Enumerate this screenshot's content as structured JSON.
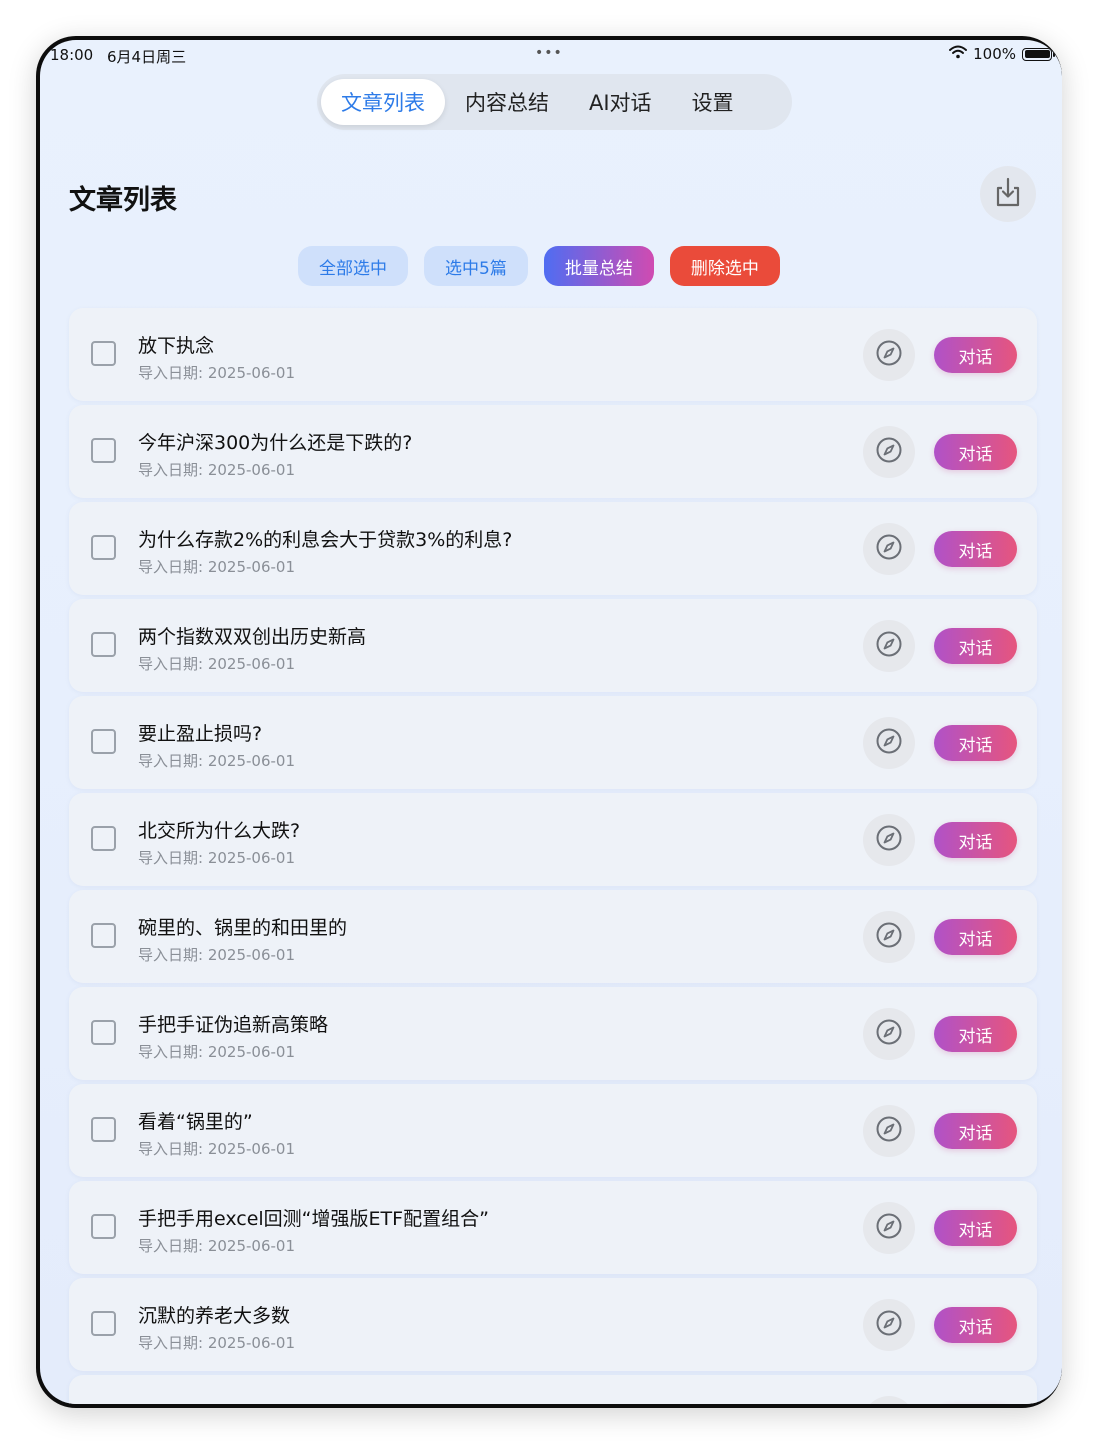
{
  "status_bar": {
    "time": "18:00",
    "date": "6月4日周三",
    "dots": "•••",
    "battery": "100%"
  },
  "tabs": [
    {
      "label": "文章列表",
      "active": true
    },
    {
      "label": "内容总结",
      "active": false
    },
    {
      "label": "AI对话",
      "active": false
    },
    {
      "label": "设置",
      "active": false
    }
  ],
  "page": {
    "title": "文章列表",
    "export_icon": "download-tray-icon"
  },
  "actions": {
    "select_all": "全部选中",
    "select_count": "选中5篇",
    "batch_summary": "批量总结",
    "delete_selected": "删除选中"
  },
  "row_labels": {
    "chat": "对话",
    "compass_icon": "compass-icon"
  },
  "articles": [
    {
      "title": "放下执念",
      "date": "导入日期: 2025-06-01"
    },
    {
      "title": "今年沪深300为什么还是下跌的?",
      "date": "导入日期: 2025-06-01"
    },
    {
      "title": "为什么存款2%的利息会大于贷款3%的利息?",
      "date": "导入日期: 2025-06-01"
    },
    {
      "title": "两个指数双双创出历史新高",
      "date": "导入日期: 2025-06-01"
    },
    {
      "title": "要止盈止损吗?",
      "date": "导入日期: 2025-06-01"
    },
    {
      "title": "北交所为什么大跌?",
      "date": "导入日期: 2025-06-01"
    },
    {
      "title": "碗里的、锅里的和田里的",
      "date": "导入日期: 2025-06-01"
    },
    {
      "title": "手把手证伪追新高策略",
      "date": "导入日期: 2025-06-01"
    },
    {
      "title": "看着“锅里的”",
      "date": "导入日期: 2025-06-01"
    },
    {
      "title": "手把手用excel回测“增强版ETF配置组合”",
      "date": "导入日期: 2025-06-01"
    },
    {
      "title": "沉默的养老大多数",
      "date": "导入日期: 2025-06-01"
    },
    {
      "title": "",
      "date": ""
    }
  ],
  "colors": {
    "accent": "#2d7be8",
    "delete": "#ea4b3a",
    "chat_gradient_start": "#b052c8",
    "chat_gradient_end": "#e6557e"
  }
}
